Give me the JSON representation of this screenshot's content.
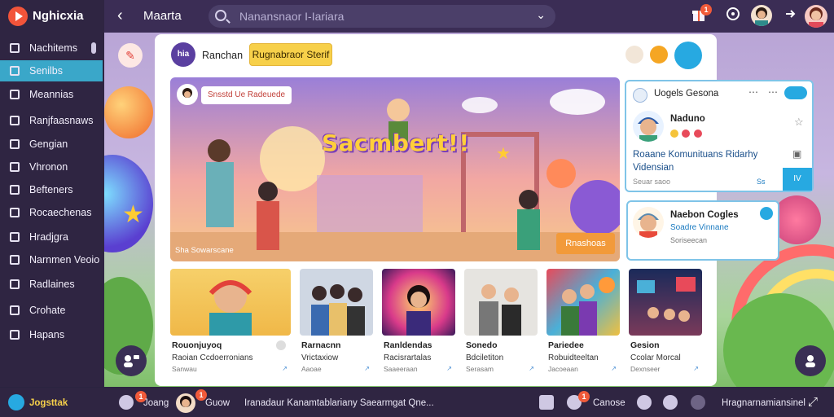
{
  "app": {
    "name": "Nghicxia"
  },
  "header": {
    "title": "Maarta",
    "search_placeholder": "Nanansnaor I-Iariara",
    "notification_count": "1"
  },
  "sidebar": {
    "items": [
      {
        "label": "Nachitems"
      },
      {
        "label": "Senilbs"
      },
      {
        "label": "Meannias"
      },
      {
        "label": "Ranjfaasnaws"
      },
      {
        "label": "Gengian"
      },
      {
        "label": "Vhronon"
      },
      {
        "label": "Befteners"
      },
      {
        "label": "Rocaechenas"
      },
      {
        "label": "Hradjgra"
      },
      {
        "label": "Narnmen Veoio"
      },
      {
        "label": "Radlaines"
      },
      {
        "label": "Crohate"
      },
      {
        "label": "Hapans"
      }
    ],
    "active_index": 1,
    "footer_label": "Jogsttak"
  },
  "channel": {
    "avatar_text": "hia",
    "name": "Ranchan",
    "subscribe_label": "Rugnabraor Sterif"
  },
  "hero": {
    "chip": "Snsstd Ue Radeuede",
    "title": "Sacmbert!!",
    "cta": "Rnashoas",
    "caption": "Sha Sowarscane"
  },
  "cards": [
    {
      "title": "Rouonjuyoq",
      "subtitle": "Raoian Ccdoerronians",
      "meta": "Sanwau"
    },
    {
      "title": "Rarnacnn",
      "subtitle": "Vrictaxiow",
      "meta": "Aaoae"
    },
    {
      "title": "Ranldendas",
      "subtitle": "Racisrartalas",
      "meta": "Saaeeraan"
    },
    {
      "title": "Sonedo",
      "subtitle": "Bdciletiton",
      "meta": "Serasam"
    },
    {
      "title": "Pariedee",
      "subtitle": "Robuidteeltan",
      "meta": "Jacoeaan"
    },
    {
      "title": "Gesion",
      "subtitle": "Ccolar Morcal",
      "meta": "Dexnseer"
    }
  ],
  "notification_panel": {
    "title": "Uogels Gesona",
    "user": "Naduno",
    "message_line1": "Roaane Komunituans Ridarhy",
    "message_line2": "Vidensian",
    "meta": "Seuar saoo",
    "counter_a": "Ss",
    "counter_b": "IV"
  },
  "friend_panel": {
    "name": "Naebon Cogles",
    "tag": "Soadre Vinnane",
    "meta": "Soriseecan"
  },
  "bottombar": {
    "user1": "Joang",
    "user1_badge": "1",
    "user2": "Guow",
    "user2_badge": "1",
    "status": "Iranadaur Kanamtablariany Saearmgat Qne...",
    "center_label": "Canose",
    "right_label": "Hragnarnamiansinel"
  },
  "colors": {
    "accent": "#3aa7c9",
    "brand": "#f2543a",
    "cta": "#f7d04a"
  }
}
